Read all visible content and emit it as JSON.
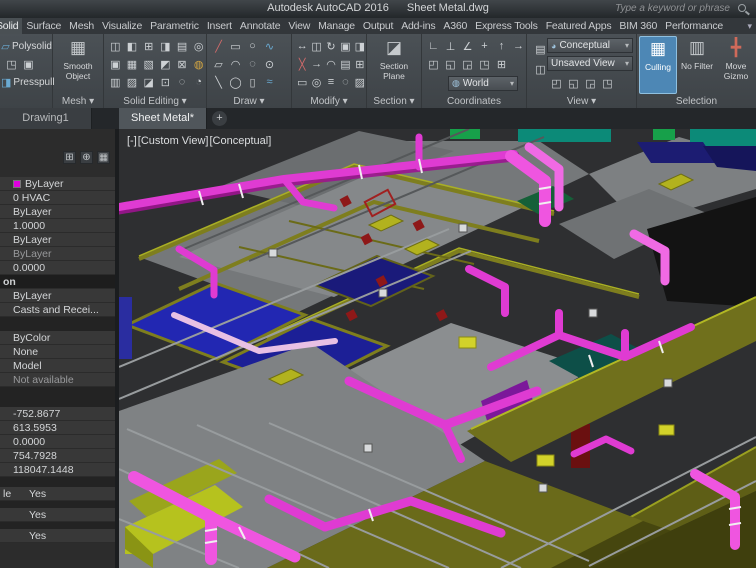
{
  "window": {
    "app_title": "Autodesk AutoCAD 2016",
    "doc_title": "Sheet Metal.dwg",
    "search_placeholder": "Type a keyword or phrase"
  },
  "ui": {
    "arrow": "▾",
    "plus": "+"
  },
  "menu": {
    "tabs": [
      {
        "label": "Solid",
        "active": true
      },
      {
        "label": "Surface"
      },
      {
        "label": "Mesh"
      },
      {
        "label": "Visualize"
      },
      {
        "label": "Parametric"
      },
      {
        "label": "Insert"
      },
      {
        "label": "Annotate"
      },
      {
        "label": "View"
      },
      {
        "label": "Manage"
      },
      {
        "label": "Output"
      },
      {
        "label": "Add-ins"
      },
      {
        "label": "A360"
      },
      {
        "label": "Express Tools"
      },
      {
        "label": "Featured Apps"
      },
      {
        "label": "BIM 360"
      },
      {
        "label": "Performance"
      }
    ]
  },
  "ribbon": {
    "crop": {
      "polysolid_label": "Polysolid",
      "polysolid_glyph": "▱",
      "presspull_label": "Presspull",
      "presspull_glyph": "◨",
      "mid_icons": [
        [
          {
            "g": "◳",
            "n": "solid-history"
          },
          {
            "g": "▣",
            "n": "primitive-box"
          }
        ]
      ]
    },
    "mesh": {
      "label": "Mesh ▾",
      "big_label": "Smooth Object",
      "big_glyph": "▦"
    },
    "solid_editing": {
      "label": "Solid Editing ▾",
      "icons": [
        [
          {
            "g": "◫",
            "n": "union"
          },
          {
            "g": "◧",
            "n": "subtract"
          },
          {
            "g": "⊞",
            "n": "intersect"
          },
          {
            "g": "◨",
            "n": "slice"
          },
          {
            "g": "▤",
            "n": "thicken"
          },
          {
            "g": "◎",
            "n": "interfere"
          }
        ],
        [
          {
            "g": "▣",
            "n": "extrude-faces"
          },
          {
            "g": "▦",
            "n": "move-faces"
          },
          {
            "g": "▧",
            "n": "offset-faces"
          },
          {
            "g": "◩",
            "n": "delete-faces"
          },
          {
            "g": "⊠",
            "n": "rotate-faces"
          },
          {
            "g": "◍",
            "n": "color-faces",
            "c": "#d2a542"
          }
        ],
        [
          {
            "g": "▥",
            "n": "shell"
          },
          {
            "g": "▨",
            "n": "separate"
          },
          {
            "g": "◪",
            "n": "clean"
          },
          {
            "g": "⊡",
            "n": "check"
          },
          {
            "g": "◌",
            "n": "imprint"
          },
          {
            "g": "◔",
            "n": "offset-edge"
          }
        ]
      ]
    },
    "draw": {
      "label": "Draw ▾",
      "icons": [
        [
          {
            "g": "╱",
            "n": "line",
            "c": "#d26a6a"
          },
          {
            "g": "▭",
            "n": "rectangle"
          },
          {
            "g": "○",
            "n": "circle"
          },
          {
            "g": "∿",
            "n": "spline",
            "c": "#6aaad2"
          }
        ],
        [
          {
            "g": "▱",
            "n": "polyline"
          },
          {
            "g": "◠",
            "n": "arc"
          },
          {
            "g": "◌",
            "n": "point"
          },
          {
            "g": "⊙",
            "n": "donut"
          }
        ],
        [
          {
            "g": "╲",
            "n": "construction-line"
          },
          {
            "g": "◯",
            "n": "ellipse"
          },
          {
            "g": "▯",
            "n": "region"
          },
          {
            "g": "≈",
            "n": "hatch",
            "c": "#6aaad2"
          }
        ]
      ]
    },
    "modify": {
      "label": "Modify ▾",
      "icons": [
        [
          {
            "g": "↔",
            "n": "move"
          },
          {
            "g": "◫",
            "n": "copy"
          },
          {
            "g": "↻",
            "n": "rotate"
          },
          {
            "g": "▣",
            "n": "scale"
          },
          {
            "g": "◨",
            "n": "mirror"
          }
        ],
        [
          {
            "g": "╳",
            "n": "trim",
            "c": "#d26a6a"
          },
          {
            "g": "→",
            "n": "extend"
          },
          {
            "g": "◠",
            "n": "fillet"
          },
          {
            "g": "▤",
            "n": "array"
          },
          {
            "g": "⊞",
            "n": "stretch"
          }
        ],
        [
          {
            "g": "▭",
            "n": "erase"
          },
          {
            "g": "◎",
            "n": "offset"
          },
          {
            "g": "≡",
            "n": "align"
          },
          {
            "g": "◌",
            "n": "break"
          },
          {
            "g": "▨",
            "n": "explode"
          }
        ]
      ]
    },
    "section": {
      "label": "Section ▾",
      "big_label": "Section Plane",
      "big_glyph": "◪"
    },
    "coordinates": {
      "label": "Coordinates",
      "icons": [
        [
          {
            "g": "∟",
            "n": "ucs-world"
          },
          {
            "g": "⊥",
            "n": "ucs-origin"
          },
          {
            "g": "∠",
            "n": "ucs-face"
          },
          {
            "g": "+",
            "n": "ucs-view"
          },
          {
            "g": "↑",
            "n": "ucs-z-axis"
          },
          {
            "g": "→",
            "n": "ucs-x-axis"
          }
        ],
        [
          {
            "g": "◰",
            "n": "ucs-named"
          },
          {
            "g": "◱",
            "n": "ucs-previous"
          },
          {
            "g": "◲",
            "n": "ucs-object"
          },
          {
            "g": "◳",
            "n": "ucs-3point"
          },
          {
            "g": "⊞",
            "n": "ucs-settings"
          }
        ]
      ],
      "world_value": "World",
      "world_icon": "◍"
    },
    "view": {
      "label": "View ▾",
      "left_icons": [
        [
          {
            "g": "▤",
            "n": "viewport-configuration"
          }
        ],
        [
          {
            "g": "◫",
            "n": "named-views"
          }
        ]
      ],
      "style_icon": "◕",
      "visual_style": "Conceptual",
      "named_view": "Unsaved View",
      "bottom_icons": [
        [
          {
            "g": "◰",
            "n": "viewport-single"
          },
          {
            "g": "◱",
            "n": "viewport-two"
          },
          {
            "g": "◲",
            "n": "viewport-three"
          },
          {
            "g": "◳",
            "n": "viewport-four"
          }
        ]
      ]
    },
    "selection": {
      "label": "Selection",
      "buttons": [
        {
          "label": "Culling",
          "glyph": "▦",
          "n": "culling",
          "active": true
        },
        {
          "label": "No Filter",
          "glyph": "▥",
          "n": "no-filter"
        },
        {
          "label": "Move Gizmo",
          "glyph": "╋",
          "n": "move-gizmo",
          "gc": "#d06a5a"
        }
      ]
    }
  },
  "file_tabs": {
    "tabs": [
      {
        "label": "Drawing1"
      },
      {
        "label": "Sheet Metal*",
        "active": true
      }
    ],
    "new_tab_label": "+"
  },
  "viewport": {
    "controls": [
      {
        "label": "[-]",
        "n": "viewport-menu"
      },
      {
        "label": "[Custom View]",
        "n": "view-name"
      },
      {
        "label": "[Conceptual]",
        "n": "visual-style"
      }
    ]
  },
  "properties": {
    "toolbar_icons": [
      [
        {
          "g": "⊞",
          "n": "quick-select"
        },
        {
          "g": "⊕",
          "n": "pick-add-toggle"
        },
        {
          "g": "▦",
          "n": "select-objects"
        }
      ]
    ],
    "rows": [
      {
        "t": "v",
        "text": "ByLayer",
        "swatch": "#e000e0"
      },
      {
        "t": "v",
        "text": "0 HVAC"
      },
      {
        "t": "v",
        "text": "ByLayer"
      },
      {
        "t": "v",
        "text": "1.0000"
      },
      {
        "t": "v",
        "text": "ByLayer"
      },
      {
        "t": "v",
        "text": "ByLayer",
        "dim": true
      },
      {
        "t": "v",
        "text": "0.0000"
      },
      {
        "t": "h",
        "text": "on"
      },
      {
        "t": "v",
        "text": "ByLayer"
      },
      {
        "t": "v",
        "text": "Casts and Recei..."
      },
      {
        "t": "g",
        "h": 14
      },
      {
        "t": "v",
        "text": "ByColor"
      },
      {
        "t": "v",
        "text": "None"
      },
      {
        "t": "v",
        "text": "Model"
      },
      {
        "t": "v",
        "text": "Not available",
        "dim": true
      },
      {
        "t": "g",
        "h": 20
      },
      {
        "t": "v",
        "text": "-752.8677"
      },
      {
        "t": "v",
        "text": "613.5953"
      },
      {
        "t": "v",
        "text": "0.0000"
      },
      {
        "t": "v",
        "text": "754.7928"
      },
      {
        "t": "v",
        "text": "118047.1448"
      },
      {
        "t": "g",
        "h": 10
      },
      {
        "t": "lv",
        "label": "le",
        "text": "Yes"
      },
      {
        "t": "g",
        "h": 7
      },
      {
        "t": "lv",
        "label": "",
        "text": "Yes"
      },
      {
        "t": "g",
        "h": 7
      },
      {
        "t": "lv",
        "label": "",
        "text": "Yes"
      }
    ]
  },
  "colors": {
    "duct_magenta": "#df3bd2",
    "duct_bright": "#ef55e0",
    "wall_olive": "#70701c",
    "floor_blue": "#2227b2",
    "slab_gray": "#85888a",
    "teal": "#0c8a78",
    "culling_highlight": "#4d87b5",
    "swatch_magenta": "#e000e0"
  }
}
